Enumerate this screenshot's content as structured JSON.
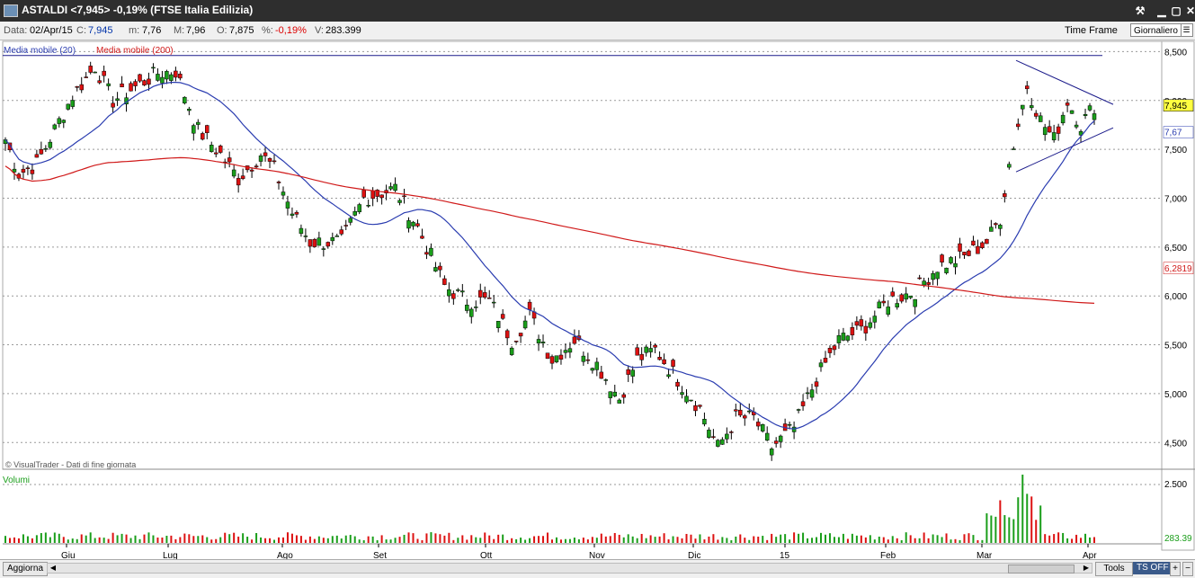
{
  "window": {
    "title": "ASTALDI <7,945> -0,19%  (FTSE Italia Edilizia)",
    "buttons": {
      "tool": "⚒",
      "minimize": "▢",
      "restore": "▢",
      "close": "✕"
    }
  },
  "infobar": {
    "date_label": "Data:",
    "date": "02/Apr/15",
    "close_label": "C:",
    "close": "7,945",
    "min_label": "m:",
    "min": "7,76",
    "max_label": "M:",
    "max": "7,96",
    "open_label": "O:",
    "open": "7,875",
    "pct_label": "%:",
    "pct": "-0,19%",
    "vol_label": "V:",
    "volume": "283.399",
    "timeframe_label": "Time Frame",
    "timeframe_value": "Giornaliero"
  },
  "bottom": {
    "refresh_label": "Aggiorna",
    "tools_label": "Tools",
    "ts_label": "TS OFF",
    "plus": "+",
    "minus": "−"
  },
  "chart_data": [
    {
      "type": "candlestick",
      "legend": [
        "Media mobile (20)",
        "Media mobile (200)"
      ],
      "watermark": "© VisualTrader - Dati di fine giornata",
      "y_ticks": [
        "8,500",
        "8,000",
        "7,500",
        "7,000",
        "6,500",
        "6,000",
        "5,500",
        "5,000",
        "4,500"
      ],
      "y_tick_values": [
        8.5,
        8.0,
        7.5,
        7.0,
        6.5,
        6.0,
        5.5,
        5.0,
        4.5
      ],
      "ylim": [
        4.3,
        8.55
      ],
      "x_ticks": [
        "Giu",
        "Lug",
        "Ago",
        "Set",
        "Ott",
        "Nov",
        "Dic",
        "15",
        "Feb",
        "Mar",
        "Apr"
      ],
      "last_price_label": "7,945",
      "ma20_label": "7,67",
      "ma200_label": "6,2819",
      "colors": {
        "up": "#1a9e1a",
        "down": "#dd1111",
        "ma20": "#2a3cb0",
        "ma200": "#d01a1a",
        "grid": "#9a9a9a",
        "trendline": "#1a1a8a"
      },
      "price_path_anchors": [
        {
          "day": 0,
          "close": 7.6
        },
        {
          "day": 3,
          "close": 7.25
        },
        {
          "day": 7,
          "close": 7.35
        },
        {
          "day": 15,
          "close": 8.05
        },
        {
          "day": 20,
          "close": 8.35
        },
        {
          "day": 24,
          "close": 8.0
        },
        {
          "day": 34,
          "close": 8.28
        },
        {
          "day": 38,
          "close": 8.3
        },
        {
          "day": 43,
          "close": 7.7
        },
        {
          "day": 48,
          "close": 7.45
        },
        {
          "day": 52,
          "close": 7.2
        },
        {
          "day": 57,
          "close": 7.45
        },
        {
          "day": 60,
          "close": 7.3
        },
        {
          "day": 64,
          "close": 6.85
        },
        {
          "day": 68,
          "close": 6.55
        },
        {
          "day": 75,
          "close": 6.55
        },
        {
          "day": 80,
          "close": 7.0
        },
        {
          "day": 87,
          "close": 7.1
        },
        {
          "day": 92,
          "close": 6.7
        },
        {
          "day": 98,
          "close": 6.1
        },
        {
          "day": 103,
          "close": 5.95
        },
        {
          "day": 108,
          "close": 5.95
        },
        {
          "day": 113,
          "close": 5.55
        },
        {
          "day": 117,
          "close": 5.8
        },
        {
          "day": 122,
          "close": 5.35
        },
        {
          "day": 127,
          "close": 5.55
        },
        {
          "day": 132,
          "close": 5.3
        },
        {
          "day": 137,
          "close": 4.95
        },
        {
          "day": 141,
          "close": 5.35
        },
        {
          "day": 145,
          "close": 5.45
        },
        {
          "day": 150,
          "close": 5.15
        },
        {
          "day": 155,
          "close": 4.85
        },
        {
          "day": 159,
          "close": 4.45
        },
        {
          "day": 163,
          "close": 4.75
        },
        {
          "day": 167,
          "close": 4.75
        },
        {
          "day": 171,
          "close": 4.45
        },
        {
          "day": 176,
          "close": 4.65
        },
        {
          "day": 181,
          "close": 5.15
        },
        {
          "day": 186,
          "close": 5.55
        },
        {
          "day": 191,
          "close": 5.65
        },
        {
          "day": 197,
          "close": 5.95
        },
        {
          "day": 203,
          "close": 6.05
        },
        {
          "day": 208,
          "close": 6.3
        },
        {
          "day": 214,
          "close": 6.4
        },
        {
          "day": 219,
          "close": 6.55
        },
        {
          "day": 222,
          "close": 6.8
        },
        {
          "day": 224,
          "close": 7.35
        },
        {
          "day": 226,
          "close": 7.75
        },
        {
          "day": 228,
          "close": 8.15
        },
        {
          "day": 231,
          "close": 7.8
        },
        {
          "day": 234,
          "close": 7.6
        },
        {
          "day": 237,
          "close": 8.0
        },
        {
          "day": 240,
          "close": 7.75
        },
        {
          "day": 243,
          "close": 7.95
        }
      ],
      "volume_panel": {
        "label": "Volumi",
        "ticks": [
          "2.500"
        ],
        "last_label": "283.39"
      }
    }
  ]
}
